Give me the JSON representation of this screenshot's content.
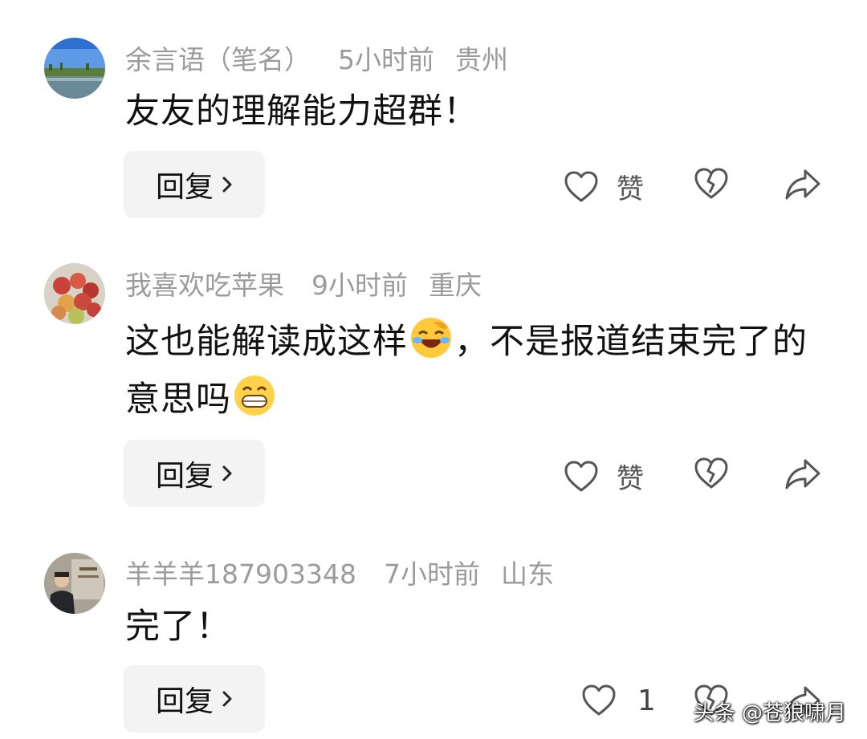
{
  "comments": [
    {
      "author": "余言语（笔名）",
      "time": "5小时前",
      "location": "贵州",
      "text": "友友的理解能力超群！",
      "reply_label": "回复",
      "like_label": "赞",
      "avatar_icon": "lake-landscape-avatar"
    },
    {
      "author": "我喜欢吃苹果",
      "time": "9小时前",
      "location": "重庆",
      "text_before_emoji": "这也能解读成这样",
      "emoji_1": "laughing-face-emoji",
      "text_after_emoji": "，不是报道结束完了的意思吗",
      "emoji_2": "grinning-face-emoji",
      "reply_label": "回复",
      "like_label": "赞",
      "avatar_icon": "apples-avatar"
    },
    {
      "author": "羊羊羊187903348",
      "time": "7小时前",
      "location": "山东",
      "text": "完了！",
      "reply_label": "回复",
      "like_count": "1",
      "avatar_icon": "person-photo-avatar"
    }
  ],
  "watermark": "头条 @苍狼啸月",
  "colors": {
    "meta": "#9b9b9b",
    "text": "#111111",
    "reply_bg": "#f3f3f3",
    "icon": "#555555"
  }
}
